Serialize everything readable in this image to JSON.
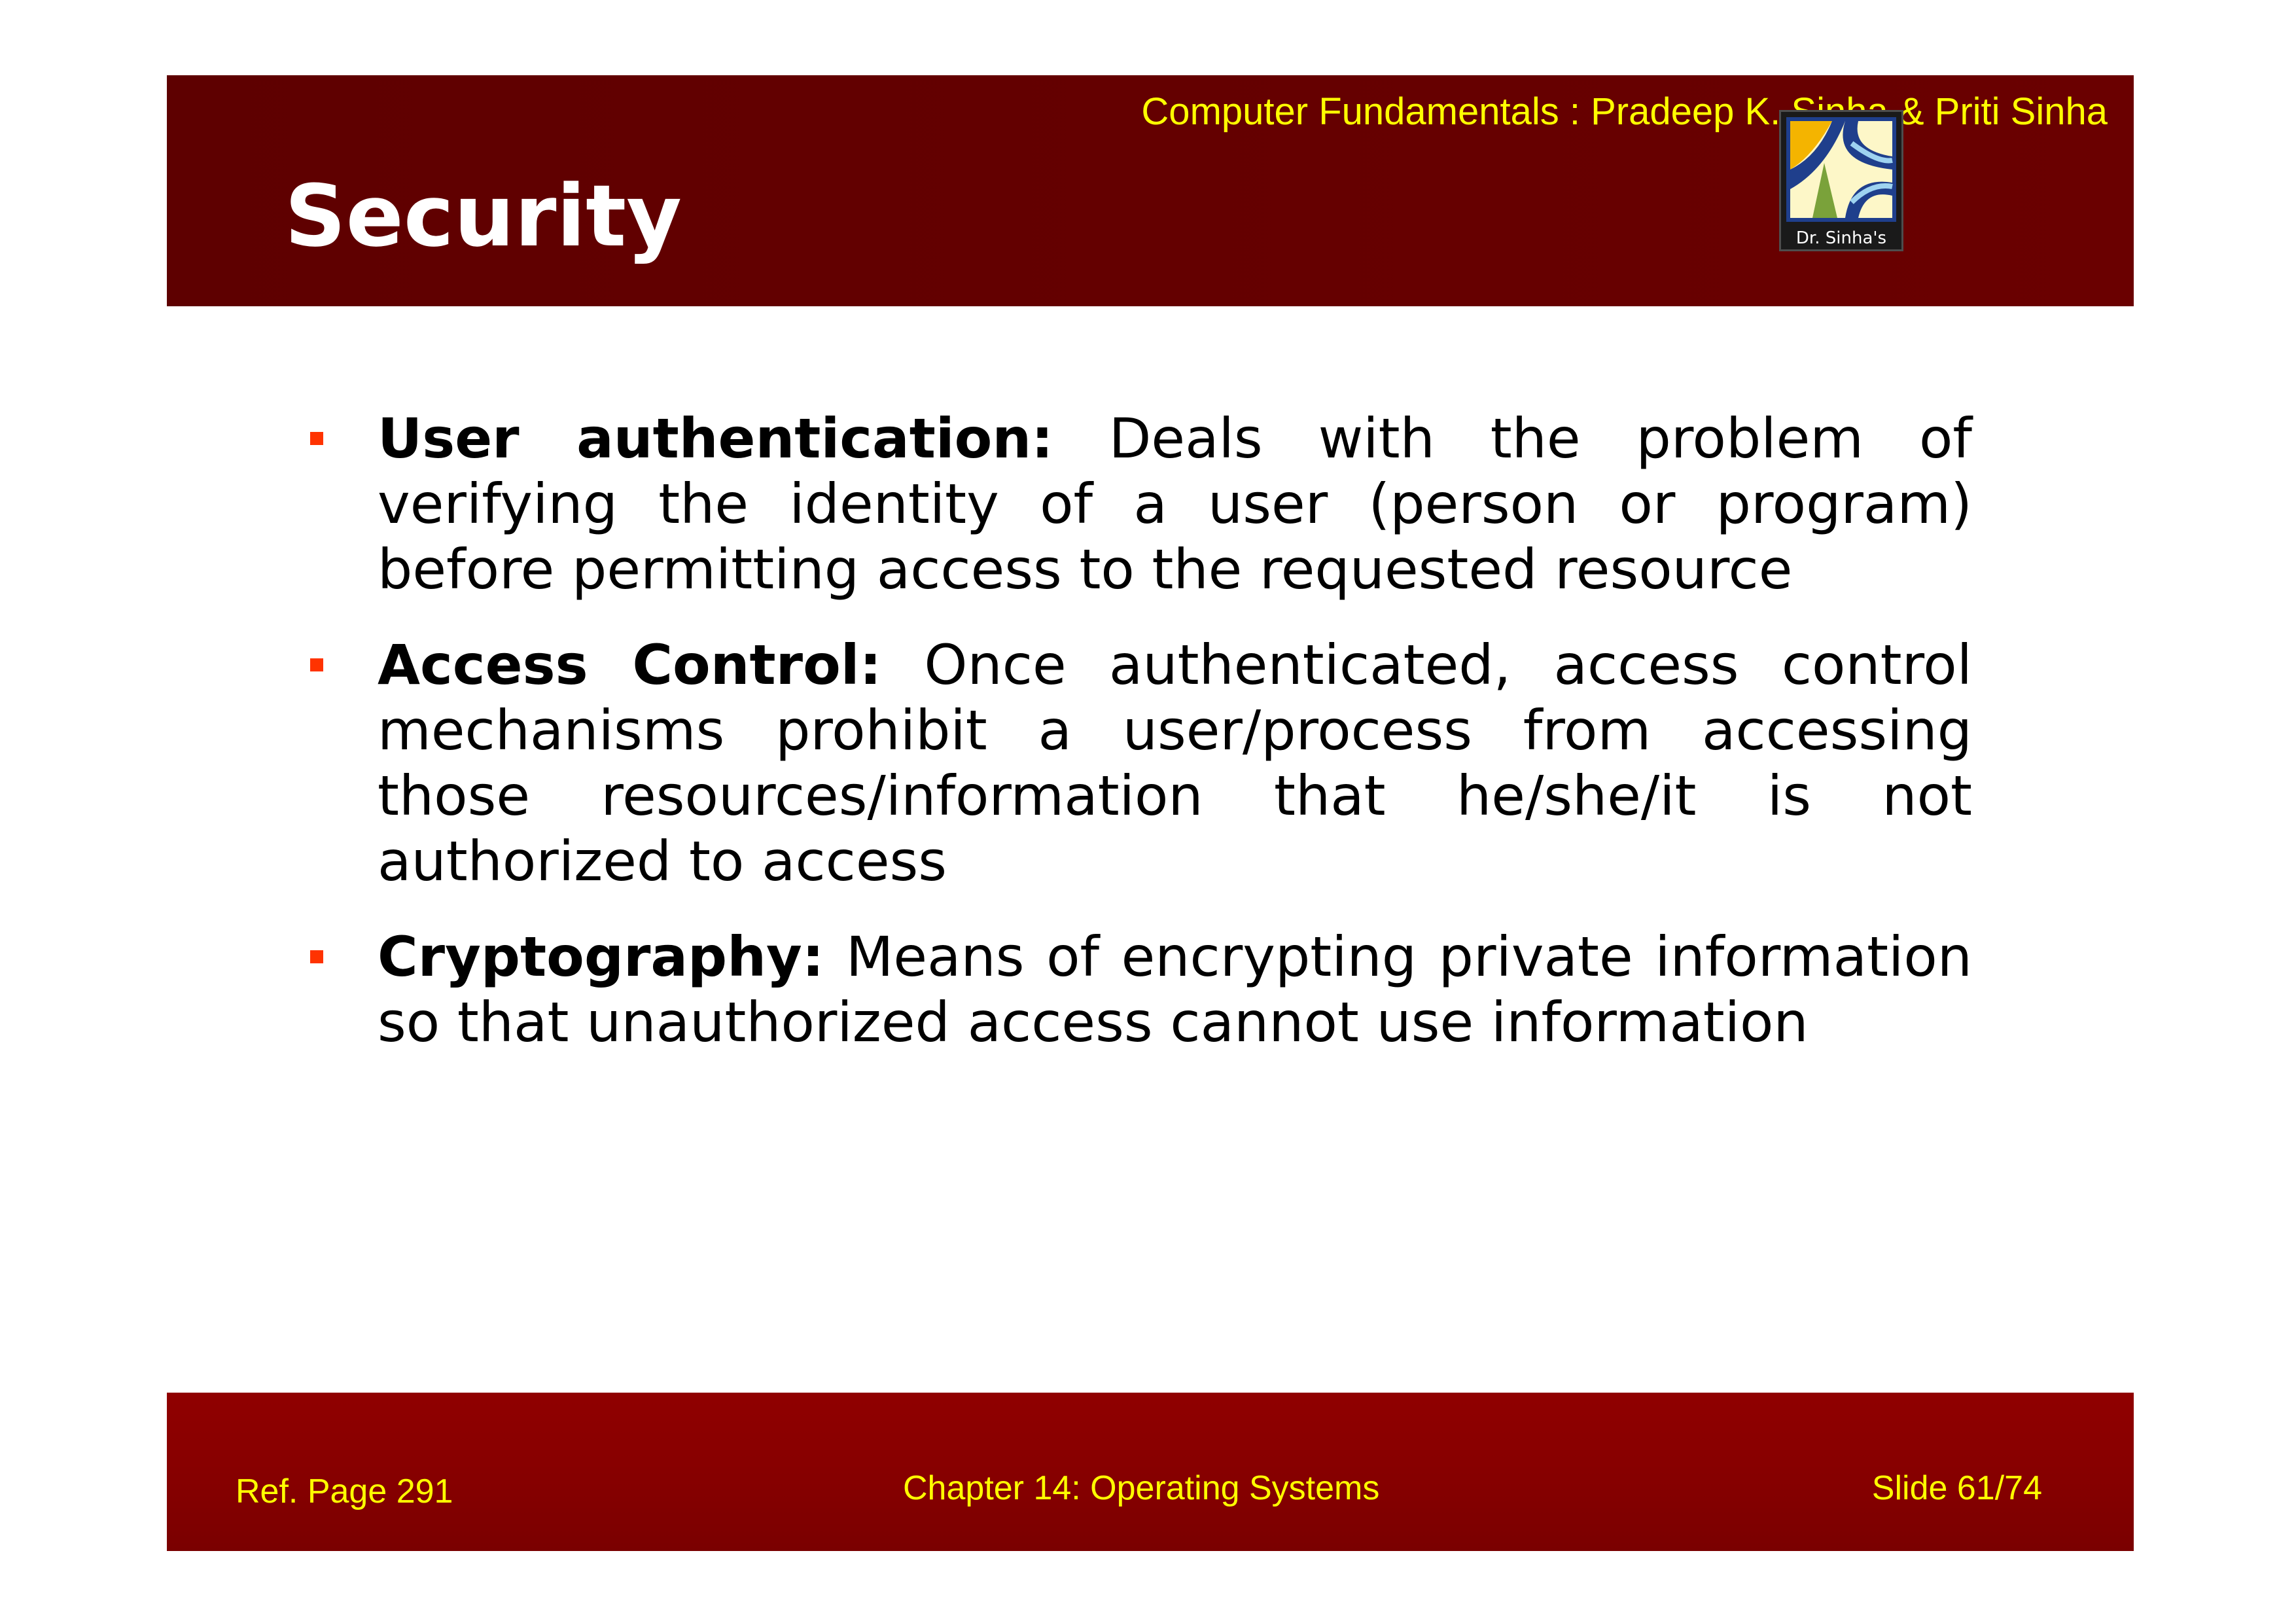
{
  "header": {
    "book_credit": "Computer Fundamentals : Pradeep K. Sinha & Priti Sinha",
    "title": "Security",
    "logo": {
      "icon": "dr-sinhas-logo-icon",
      "caption": "Dr. Sinha's"
    }
  },
  "content": {
    "bullets": [
      {
        "term": "User authentication:",
        "text": " Deals with the problem of verifying the identity of a user (person or program) before permitting access to the requested resource"
      },
      {
        "term": "Access Control:",
        "text": " Once authenticated, access control mechanisms prohibit a user/process from accessing those resources/information that he/she/it is not authorized to access"
      },
      {
        "term": "Cryptography:",
        "text": " Means of encrypting private information so that unauthorized access cannot use information"
      }
    ]
  },
  "footer": {
    "ref_page": "Ref. Page  291",
    "chapter": "Chapter 14: Operating Systems",
    "slide": "Slide 61/74"
  },
  "colors": {
    "header_band": "#640000",
    "footer_band": "#880000",
    "accent_text": "#ffff00",
    "bullet": "#ff3300"
  }
}
